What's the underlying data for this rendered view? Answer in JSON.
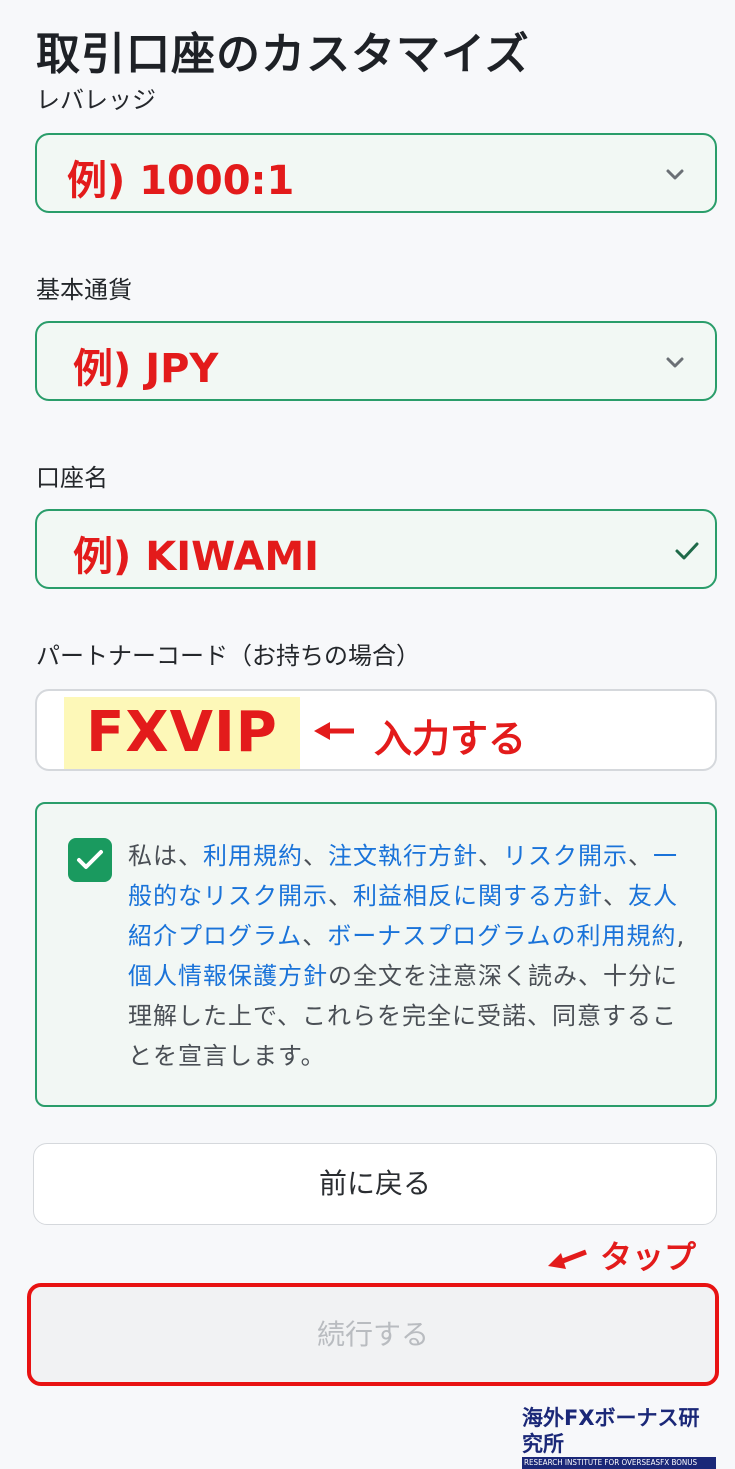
{
  "page": {
    "title": "取引口座のカスタマイズ"
  },
  "leverage": {
    "label": "レバレッジ",
    "value": "例) 1000:1"
  },
  "base_currency": {
    "label": "基本通貨",
    "value": "例) JPY"
  },
  "account_name": {
    "label": "口座名",
    "value": "例) KIWAMI"
  },
  "partner_code": {
    "label": "パートナーコード（お持ちの場合）",
    "value": "FXVIP",
    "annotation": "入力する"
  },
  "consent": {
    "checked": true,
    "prefix": "私は、",
    "links": [
      "利用規約",
      "注文執行方針",
      "リスク開示",
      "一般的なリスク開示",
      "利益相反に関する方針",
      "友人紹介プログラム",
      "ボーナスプログラムの利用規約",
      "個人情報保護方針"
    ],
    "sep1": "、",
    "sep2": "、",
    "sep3": "、",
    "sep4": "、",
    "sep5": "、",
    "sep6": "、",
    "sep7": ", ",
    "suffix": "の全文を注意深く読み、十分に理解した上で、これらを完全に受諾、同意することを宣言します。"
  },
  "buttons": {
    "back": "前に戻る",
    "continue": "続行する"
  },
  "tap_annotation": "タップ",
  "logo": {
    "main": "海外FXボーナス研究所",
    "sub": "RESEARCH INSTITUTE FOR OVERSEASFX BONUS"
  },
  "colors": {
    "accent_green": "#2a9d6a",
    "annotation_red": "#e31b1b",
    "link_blue": "#1a73d9",
    "highlight_yellow": "#fdf8b8"
  },
  "icons": {
    "select_arrow": "chevron-down-icon",
    "valid": "check-icon",
    "annotation_arrow": "arrow-left-icon",
    "checkbox": "checkbox-checked-icon"
  }
}
